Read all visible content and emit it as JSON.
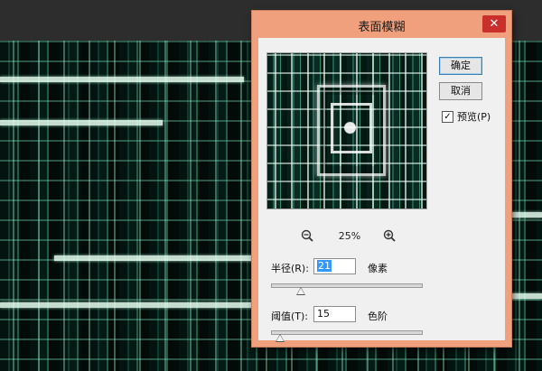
{
  "dialog": {
    "title": "表面模糊",
    "close_label": "✕",
    "buttons": {
      "ok_label": "确定",
      "cancel_label": "取消"
    },
    "preview_checkbox": {
      "label": "预览(P)",
      "checked": true
    },
    "zoom": {
      "level": "25%"
    },
    "radius": {
      "label": "半径(R):",
      "value": "21",
      "unit": "像素",
      "slider_fraction": 0.2
    },
    "threshold": {
      "label": "阈值(T):",
      "value": "15",
      "unit": "色阶",
      "slider_fraction": 0.06
    }
  },
  "colors": {
    "dialog_frame": "#f0a07c",
    "dialog_body": "#f0f0f0",
    "close_button": "#c9302c",
    "selection": "#3399ff"
  },
  "icons": {
    "zoom_out": "zoom-out-magnifier",
    "zoom_in": "zoom-in-magnifier",
    "check": "checkmark"
  }
}
